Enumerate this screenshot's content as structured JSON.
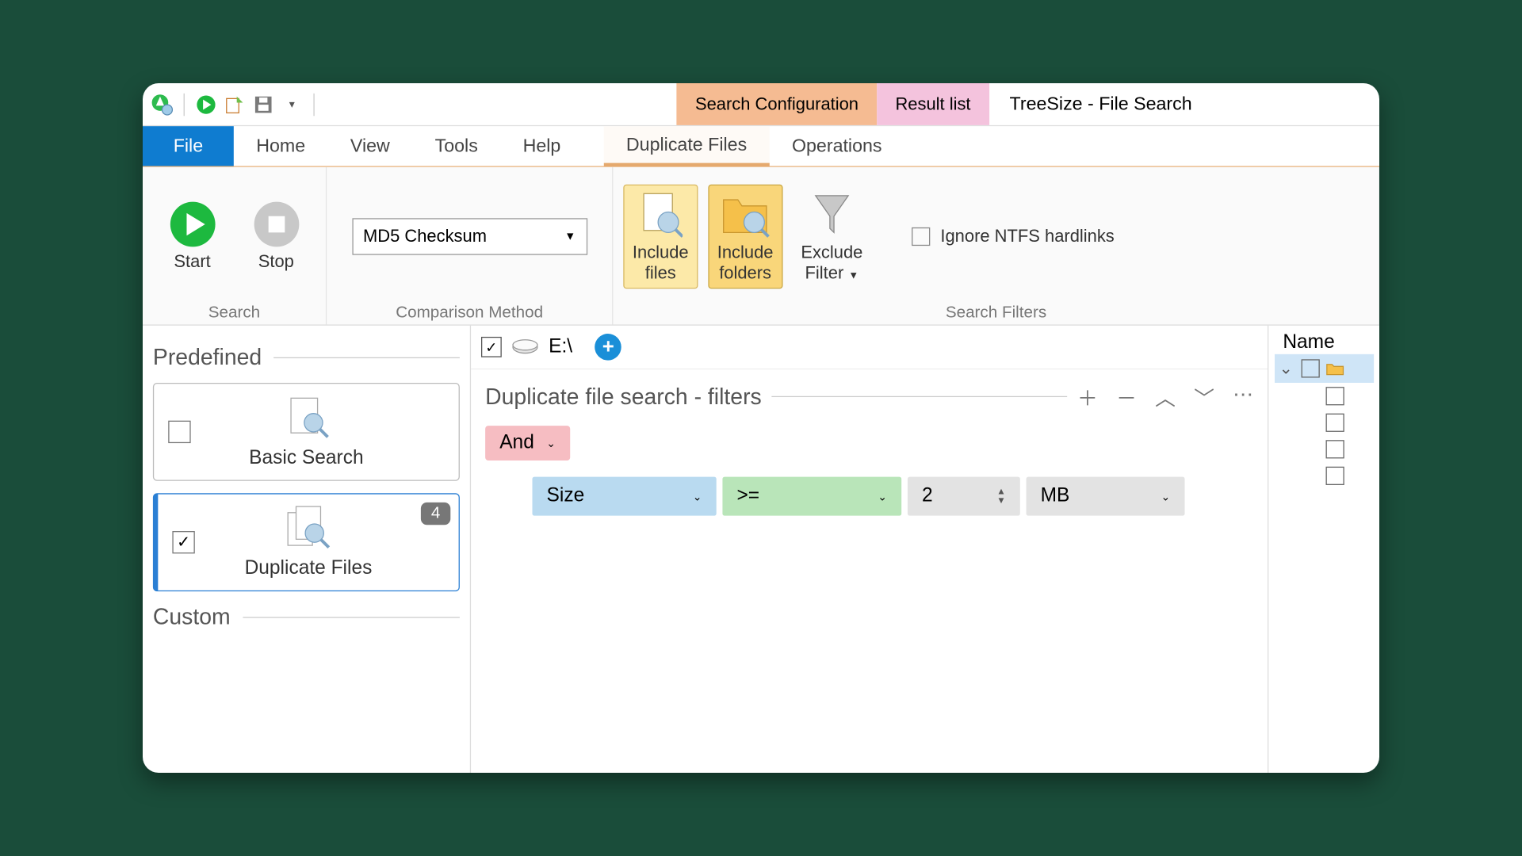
{
  "app_title": "TreeSize - File Search",
  "context_tabs": {
    "search_config": "Search Configuration",
    "result_list": "Result list"
  },
  "ribbon_tabs": {
    "file": "File",
    "home": "Home",
    "view": "View",
    "tools": "Tools",
    "help": "Help",
    "duplicate_files": "Duplicate Files",
    "operations": "Operations"
  },
  "ribbon": {
    "search_group": "Search",
    "start": "Start",
    "stop": "Stop",
    "comparison_group": "Comparison Method",
    "comparison_value": "MD5 Checksum",
    "filters_group": "Search Filters",
    "include_files": "Include\nfiles",
    "include_folders": "Include\nfolders",
    "exclude_filter": "Exclude\nFilter",
    "ignore_hardlinks": "Ignore NTFS hardlinks"
  },
  "sidebar": {
    "predefined": "Predefined",
    "custom": "Custom",
    "basic_search": "Basic Search",
    "duplicate_files": "Duplicate Files",
    "dup_badge": "4"
  },
  "path": {
    "drive": "E:\\"
  },
  "filters": {
    "title": "Duplicate file search - filters",
    "logic": "And",
    "field": "Size",
    "op": ">=",
    "value": "2",
    "unit": "MB"
  },
  "results": {
    "name_col": "Name"
  }
}
